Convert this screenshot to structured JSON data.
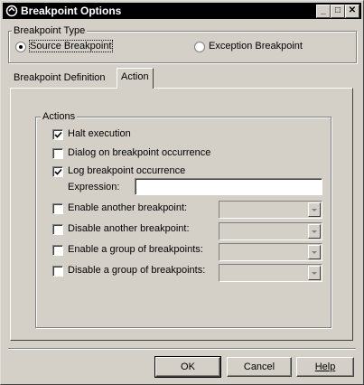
{
  "window": {
    "title": "Breakpoint Options",
    "minimize_glyph": "_",
    "maximize_glyph": "□",
    "close_glyph": "✕"
  },
  "breakpoint_type": {
    "group_label": "Breakpoint Type",
    "source_label": "Source Breakpoint",
    "exception_label": "Exception Breakpoint",
    "selected": "source"
  },
  "tabs": [
    {
      "label": "Breakpoint Definition",
      "active": false
    },
    {
      "label": "Action",
      "active": true
    }
  ],
  "actions": {
    "group_label": "Actions",
    "halt_execution": {
      "label": "Halt execution",
      "checked": true
    },
    "dialog_on_occurrence": {
      "label": "Dialog on breakpoint occurrence",
      "checked": false
    },
    "log_occurrence": {
      "label": "Log breakpoint occurrence",
      "checked": true
    },
    "expression": {
      "label": "Expression:",
      "value": ""
    },
    "enable_another": {
      "label": "Enable another breakpoint:",
      "checked": false,
      "value": ""
    },
    "disable_another": {
      "label": "Disable another breakpoint:",
      "checked": false,
      "value": ""
    },
    "enable_group": {
      "label": "Enable a group of breakpoints:",
      "checked": false,
      "value": ""
    },
    "disable_group": {
      "label": "Disable a group of breakpoints:",
      "checked": false,
      "value": ""
    }
  },
  "buttons": {
    "ok": "OK",
    "cancel": "Cancel",
    "help": "Help"
  }
}
